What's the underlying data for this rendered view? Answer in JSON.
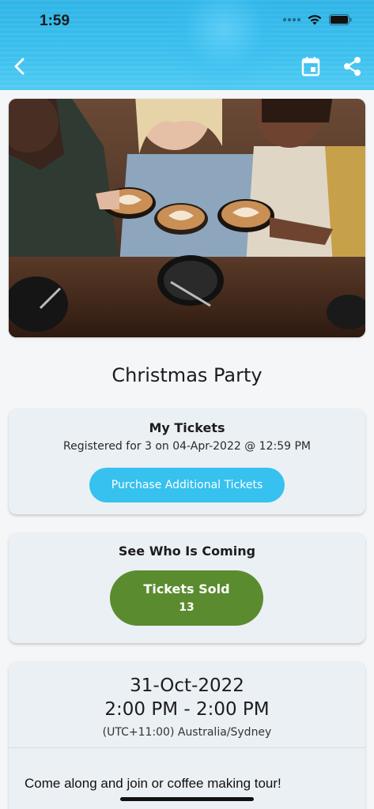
{
  "status_bar": {
    "time": "1:59"
  },
  "nav": {
    "back_icon": "chevron-left-icon",
    "calendar_icon": "calendar-icon",
    "share_icon": "share-icon"
  },
  "hero_image": {
    "description_icon": "coffee-party-photo"
  },
  "event": {
    "title": "Christmas Party"
  },
  "tickets_card": {
    "heading": "My Tickets",
    "registered_text": "Registered for 3 on 04-Apr-2022 @ 12:59 PM",
    "purchase_label": "Purchase Additional Tickets"
  },
  "coming_card": {
    "heading": "See Who Is Coming",
    "sold_label": "Tickets Sold",
    "sold_count": "13"
  },
  "details_card": {
    "date": "31-Oct-2022",
    "time_range": "2:00 PM - 2:00 PM",
    "timezone": "(UTC+11:00) Australia/Sydney",
    "description": "Come along and join or coffee making tour!"
  },
  "colors": {
    "header": "#2fb4e6",
    "purchase_button": "#36c1ef",
    "sold_button": "#5b8b2f",
    "card": "#ebf0f4"
  }
}
